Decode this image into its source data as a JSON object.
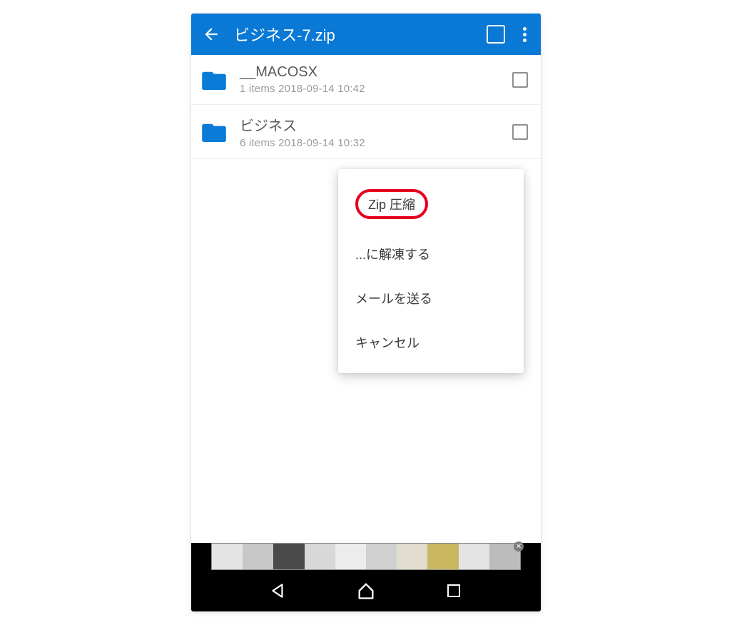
{
  "header": {
    "title": "ビジネス-7.zip"
  },
  "files": [
    {
      "name": "__MACOSX",
      "items_count": "1 items",
      "datetime": "2018-09-14 10:42"
    },
    {
      "name": "ビジネス",
      "items_count": "6 items",
      "datetime": "2018-09-14 10:32"
    }
  ],
  "menu": {
    "zip_compress": "Zip 圧縮",
    "extract_to": "...に解凍する",
    "send_email": "メールを送る",
    "cancel": "キャンセル"
  }
}
